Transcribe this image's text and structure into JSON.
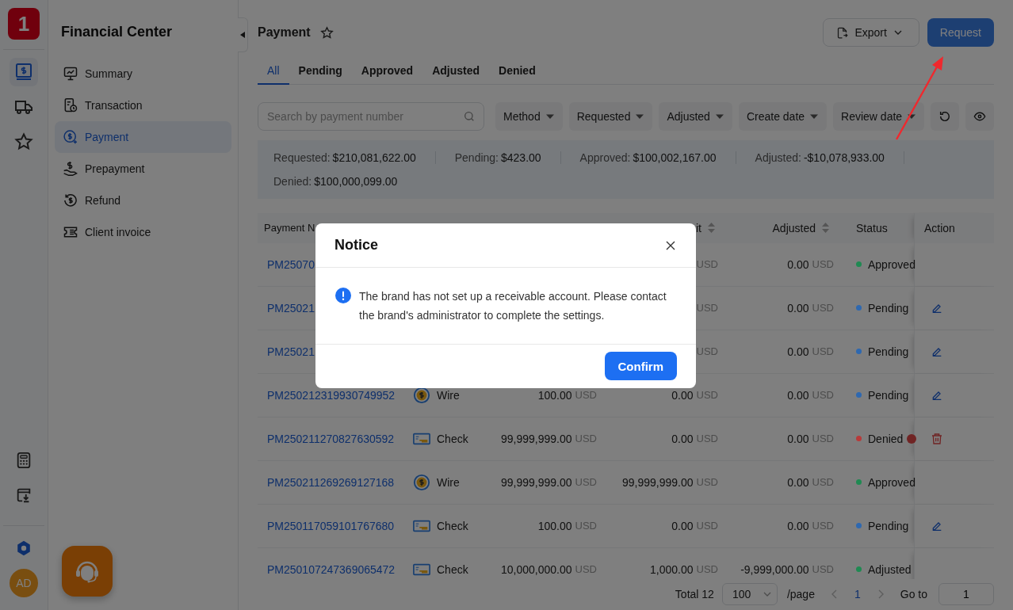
{
  "rail": {
    "logo": "1",
    "items": [
      {
        "kind": "finance",
        "selected": true
      },
      {
        "kind": "truck",
        "selected": false
      },
      {
        "kind": "star",
        "selected": false
      }
    ],
    "bottom_items": [
      {
        "kind": "calculator"
      },
      {
        "kind": "download"
      },
      {
        "kind": "gear"
      }
    ],
    "avatar": "AD"
  },
  "sidebar": {
    "title": "Financial Center",
    "items": [
      {
        "label": "Summary",
        "kind": "chart",
        "selected": false
      },
      {
        "label": "Transaction",
        "kind": "transaction",
        "selected": false
      },
      {
        "label": "Payment",
        "kind": "payment",
        "selected": true
      },
      {
        "label": "Prepayment",
        "kind": "prepayment",
        "selected": false
      },
      {
        "label": "Refund",
        "kind": "refund",
        "selected": false
      },
      {
        "label": "Client invoice",
        "kind": "invoice",
        "selected": false
      }
    ]
  },
  "page": {
    "title": "Payment",
    "export": "Export",
    "request": "Request"
  },
  "tabs": [
    {
      "label": "All",
      "selected": true
    },
    {
      "label": "Pending",
      "selected": false
    },
    {
      "label": "Approved",
      "selected": false
    },
    {
      "label": "Adjusted",
      "selected": false
    },
    {
      "label": "Denied",
      "selected": false
    }
  ],
  "search": {
    "placeholder": "Search by payment number"
  },
  "filters": [
    "Method",
    "Requested",
    "Adjusted",
    "Create date",
    "Review date"
  ],
  "summary": [
    {
      "label": "Requested:",
      "value": "$210,081,622.00"
    },
    {
      "label": "Pending:",
      "value": "$423.00"
    },
    {
      "label": "Approved:",
      "value": "$100,002,167.00"
    },
    {
      "label": "Adjusted:",
      "value": "-$10,078,933.00"
    },
    {
      "label": "Denied:",
      "value": "$100,000,099.00"
    }
  ],
  "table": {
    "columns": [
      {
        "label": "Payment N",
        "sortable": false
      },
      null,
      null,
      {
        "label": "it",
        "sortable": true
      },
      {
        "label": "Adjusted",
        "sortable": true
      },
      {
        "label": "Status",
        "sortable": false
      },
      {
        "label": "Action",
        "sortable": false
      }
    ],
    "rows": [
      {
        "payment_no": "PM25070",
        "deposit": {
          "unit": "USD"
        },
        "adjusted": {
          "value": "0.00",
          "unit": "USD"
        },
        "status": "Approved",
        "color": "#1f8a52"
      },
      {
        "payment_no": "PM25021",
        "deposit": {
          "unit": "USD"
        },
        "adjusted": {
          "value": "0.00",
          "unit": "USD"
        },
        "status": "Pending",
        "color": "#2e68b0",
        "action": {
          "kind": "edit"
        }
      },
      {
        "payment_no": "PM25021",
        "deposit": {
          "unit": "USD"
        },
        "adjusted": {
          "value": "0.00",
          "unit": "USD"
        },
        "status": "Pending",
        "color": "#2e68b0",
        "action": {
          "kind": "edit"
        }
      },
      {
        "payment_no": "PM250212319930749952",
        "method": {
          "kind": "wire",
          "label": "Wire"
        },
        "requested": {
          "value": "100.00",
          "unit": "USD"
        },
        "deposit": {
          "value": "0.00",
          "unit": "USD"
        },
        "adjusted": {
          "value": "0.00",
          "unit": "USD"
        },
        "status": "Pending",
        "color": "#2e68b0",
        "action": {
          "kind": "edit"
        }
      },
      {
        "payment_no": "PM250211270827630592",
        "method": {
          "kind": "check",
          "label": "Check"
        },
        "requested": {
          "value": "99,999,999.00",
          "unit": "USD"
        },
        "deposit": {
          "value": "0.00",
          "unit": "USD"
        },
        "adjusted": {
          "value": "0.00",
          "unit": "USD"
        },
        "status": "Denied",
        "color": "#b83a3a",
        "action": {
          "kind": "delete"
        },
        "info": true
      },
      {
        "payment_no": "PM250211269269127168",
        "method": {
          "kind": "wire",
          "label": "Wire"
        },
        "requested": {
          "value": "99,999,999.00",
          "unit": "USD"
        },
        "deposit": {
          "value": "99,999,999.00",
          "unit": "USD"
        },
        "adjusted": {
          "value": "0.00",
          "unit": "USD"
        },
        "status": "Approved",
        "color": "#1f8a52"
      },
      {
        "payment_no": "PM250117059101767680",
        "method": {
          "kind": "check",
          "label": "Check"
        },
        "requested": {
          "value": "100.00",
          "unit": "USD"
        },
        "deposit": {
          "value": "0.00",
          "unit": "USD"
        },
        "adjusted": {
          "value": "0.00",
          "unit": "USD"
        },
        "status": "Pending",
        "color": "#2e68b0",
        "action": {
          "kind": "edit"
        }
      },
      {
        "payment_no": "PM250107247369065472",
        "method": {
          "kind": "check",
          "label": "Check"
        },
        "requested": {
          "value": "10,000,000.00",
          "unit": "USD"
        },
        "deposit": {
          "value": "1,000.00",
          "unit": "USD"
        },
        "adjusted": {
          "value": "-9,999,000.00",
          "unit": "USD"
        },
        "status": "Adjusted",
        "color": "#1f8a52"
      }
    ]
  },
  "pagination": {
    "total": "Total 12",
    "page_size": "100",
    "per_page": "/page",
    "current": "1",
    "goto_label": "Go to",
    "goto_value": "1"
  },
  "modal": {
    "title": "Notice",
    "message": "The brand has not set up a receivable account. Please contact the brand's administrator to complete the settings.",
    "confirm": "Confirm"
  }
}
